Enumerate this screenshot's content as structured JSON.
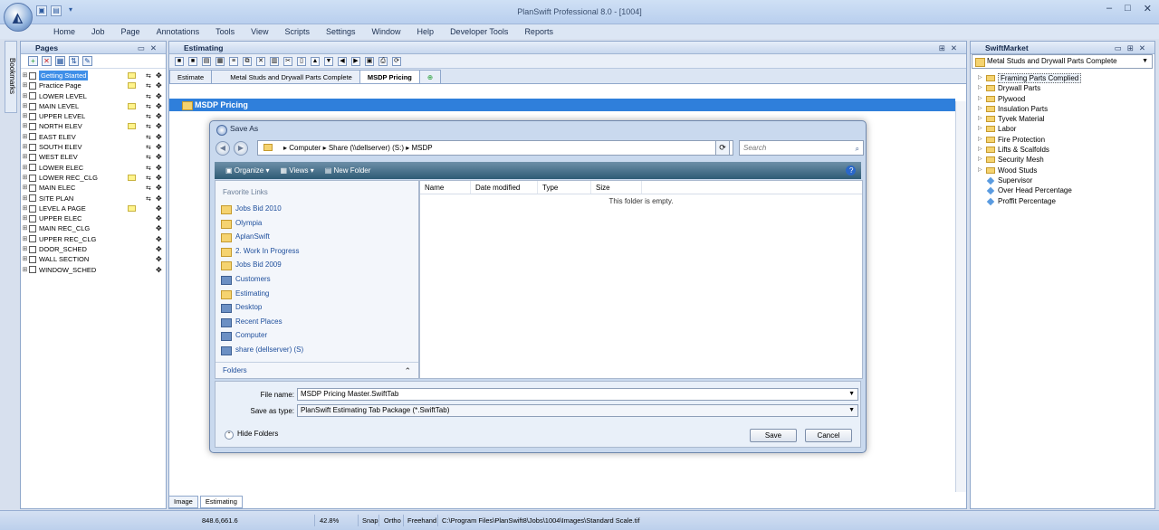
{
  "titlebar": {
    "title": "PlanSwift Professional 8.0 - [1004]",
    "qat_icons": [
      "save-icon",
      "open-folder-icon",
      "dropdown-icon"
    ]
  },
  "menu": [
    "Home",
    "Job",
    "Page",
    "Annotations",
    "Tools",
    "View",
    "Scripts",
    "Settings",
    "Window",
    "Help",
    "Developer Tools",
    "Reports"
  ],
  "bookmarks_label": "Bookmarks",
  "pages_panel": {
    "title": "Pages",
    "items": [
      {
        "label": "Getting Started",
        "selected": true,
        "note": true,
        "ext": true
      },
      {
        "label": "Practice Page",
        "note": true,
        "ext": true
      },
      {
        "label": "LOWER LEVEL",
        "note": false,
        "ext": true
      },
      {
        "label": "MAIN LEVEL",
        "note": true,
        "ext": true
      },
      {
        "label": "UPPER LEVEL",
        "note": false,
        "ext": true
      },
      {
        "label": "NORTH ELEV",
        "note": true,
        "ext": true
      },
      {
        "label": "EAST ELEV",
        "note": false,
        "ext": true
      },
      {
        "label": "SOUTH ELEV",
        "note": false,
        "ext": true
      },
      {
        "label": "WEST ELEV",
        "note": false,
        "ext": true
      },
      {
        "label": "LOWER ELEC",
        "note": false,
        "ext": true
      },
      {
        "label": "LOWER REC_CLG",
        "note": true,
        "ext": true
      },
      {
        "label": "MAIN ELEC",
        "note": false,
        "ext": true
      },
      {
        "label": "SITE PLAN",
        "note": false,
        "ext": true
      },
      {
        "label": "LEVEL A PAGE",
        "note": true,
        "ext": false
      },
      {
        "label": "UPPER ELEC",
        "note": false,
        "ext": false
      },
      {
        "label": "MAIN REC_CLG",
        "note": false,
        "ext": false
      },
      {
        "label": "UPPER REC_CLG",
        "note": false,
        "ext": false
      },
      {
        "label": "DOOR_SCHED",
        "note": false,
        "ext": false
      },
      {
        "label": "WALL SECTION",
        "note": false,
        "ext": false
      },
      {
        "label": "WINDOW_SCHED",
        "note": false,
        "ext": false
      }
    ]
  },
  "estimating": {
    "title": "Estimating",
    "tabs": [
      "Estimate",
      "Metal Studs and Drywall Parts Complete",
      "MSDP Pricing"
    ],
    "banner": "MSDP Pricing",
    "bottom_tabs": [
      "Image",
      "Estimating"
    ]
  },
  "dialog": {
    "title": "Save As",
    "path": [
      "Computer",
      "Share (\\\\dellserver) (S:)",
      "MSDP"
    ],
    "search_placeholder": "Search",
    "toolbar": [
      "Organize",
      "Views",
      "New Folder"
    ],
    "favorites_header": "Favorite Links",
    "favorites": [
      {
        "label": "Jobs Bid 2010",
        "sys": false
      },
      {
        "label": "Olympia",
        "sys": false
      },
      {
        "label": "AplanSwift",
        "sys": false
      },
      {
        "label": "2. Work In Progress",
        "sys": false
      },
      {
        "label": "Jobs Bid 2009",
        "sys": false
      },
      {
        "label": "Customers",
        "sys": true
      },
      {
        "label": "Estimating",
        "sys": false
      },
      {
        "label": "Desktop",
        "sys": true
      },
      {
        "label": "Recent Places",
        "sys": true
      },
      {
        "label": "Computer",
        "sys": true
      },
      {
        "label": "share (dellserver) (S)",
        "sys": true
      }
    ],
    "folders_label": "Folders",
    "columns": [
      "Name",
      "Date modified",
      "Type",
      "Size"
    ],
    "empty_text": "This folder is empty.",
    "file_name_label": "File name:",
    "file_name_value": "MSDP Pricing Master.SwiftTab",
    "save_type_label": "Save as type:",
    "save_type_value": "PlanSwift Estimating Tab Package (*.SwiftTab)",
    "hide_folders": "Hide Folders",
    "save_button": "Save",
    "cancel_button": "Cancel"
  },
  "swiftmarket": {
    "title": "SwiftMarket",
    "selected": "Metal Studs and Drywall Parts Complete",
    "items": [
      {
        "label": "Framing Parts Complied",
        "type": "folder"
      },
      {
        "label": "Drywall Parts",
        "type": "folder"
      },
      {
        "label": "Plywood",
        "type": "folder"
      },
      {
        "label": "Insulation Parts",
        "type": "folder"
      },
      {
        "label": "Tyvek Material",
        "type": "folder"
      },
      {
        "label": "Labor",
        "type": "folder"
      },
      {
        "label": "Fire Protection",
        "type": "folder"
      },
      {
        "label": "Lifts & Scalfolds",
        "type": "folder"
      },
      {
        "label": "Security Mesh",
        "type": "folder"
      },
      {
        "label": "Wood Studs",
        "type": "folder"
      },
      {
        "label": "Supervisor",
        "type": "item"
      },
      {
        "label": "Over Head Percentage",
        "type": "item"
      },
      {
        "label": "Proffit Percentage",
        "type": "item"
      }
    ]
  },
  "status": {
    "coords": "848.6,661.6",
    "zoom": "42.8%",
    "snap": "Snap",
    "ortho": "Ortho",
    "freehand": "Freehand",
    "path": "C:\\Program Files\\PlanSwift8\\Jobs\\1004\\Images\\Standard Scale.tif"
  }
}
